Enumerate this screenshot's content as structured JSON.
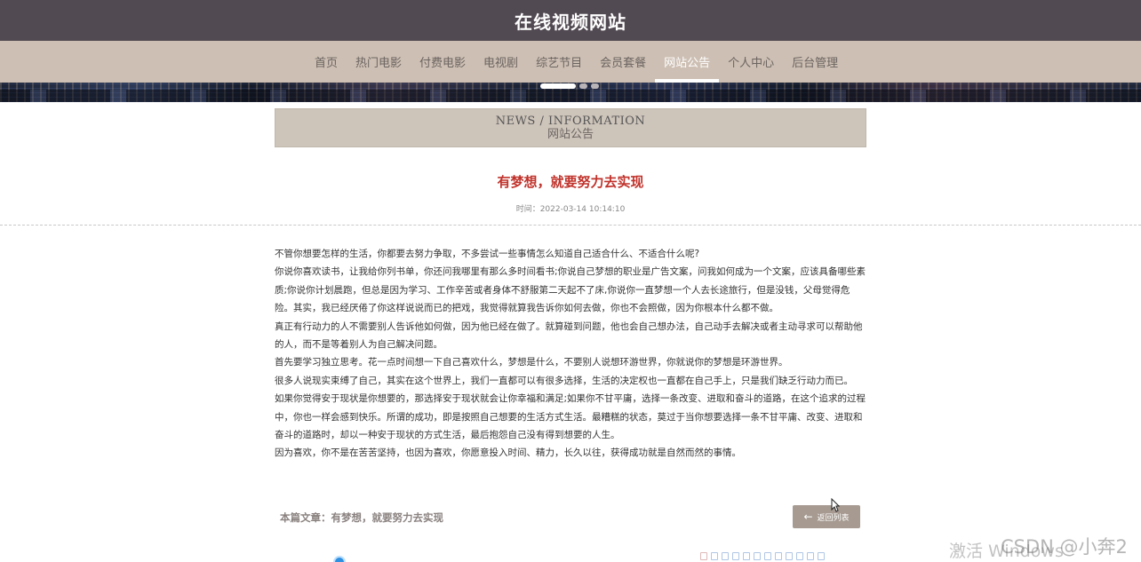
{
  "site": {
    "title": "在线视频网站"
  },
  "nav": {
    "items": [
      {
        "label": "首页",
        "active": false
      },
      {
        "label": "热门电影",
        "active": false
      },
      {
        "label": "付费电影",
        "active": false
      },
      {
        "label": "电视剧",
        "active": false
      },
      {
        "label": "综艺节目",
        "active": false
      },
      {
        "label": "会员套餐",
        "active": false
      },
      {
        "label": "网站公告",
        "active": true
      },
      {
        "label": "个人中心",
        "active": false
      },
      {
        "label": "后台管理",
        "active": false
      }
    ]
  },
  "banner": {
    "slide_count": 3,
    "active_slide": 1
  },
  "section": {
    "title_en": "NEWS / INFORMATION",
    "title_cn": "网站公告"
  },
  "article": {
    "title": "有梦想，就要努力去实现",
    "time": "时间：2022-03-14 10:14:10",
    "paragraphs": [
      "不管你想要怎样的生活，你都要去努力争取，不多尝试一些事情怎么知道自己适合什么、不适合什么呢?",
      "你说你喜欢读书，让我给你列书单，你还问我哪里有那么多时间看书;你说自己梦想的职业是广告文案，问我如何成为一个文案，应该具备哪些素质;你说你计划晨跑，但总是因为学习、工作辛苦或者身体不舒服第二天起不了床,你说你一直梦想一个人去长途旅行，但是没钱，父母觉得危险。其实，我已经厌倦了你这样说说而已的把戏，我觉得就算我告诉你如何去做，你也不会照做，因为你根本什么都不做。",
      "真正有行动力的人不需要别人告诉他如何做，因为他已经在做了。就算碰到问题，他也会自己想办法，自己动手去解决或者主动寻求可以帮助他的人，而不是等着别人为自己解决问题。",
      "首先要学习独立思考。花一点时间想一下自己喜欢什么，梦想是什么，不要别人说想环游世界，你就说你的梦想是环游世界。",
      "很多人说现实束缚了自己，其实在这个世界上，我们一直都可以有很多选择，生活的决定权也一直都在自己手上，只是我们缺乏行动力而已。",
      "如果你觉得安于现状是你想要的，那选择安于现状就会让你幸福和满足;如果你不甘平庸，选择一条改变、进取和奋斗的道路，在这个追求的过程中，你也一样会感到快乐。所谓的成功，即是按照自己想要的生活方式生活。最糟糕的状态，莫过于当你想要选择一条不甘平庸、改变、进取和奋斗的道路时，却以一种安于现状的方式生活，最后抱怨自己没有得到想要的人生。",
      "因为喜欢，你不是在苦苦坚持，也因为喜欢，你愿意投入时间、精力，长久以往，获得成功就是自然而然的事情。"
    ]
  },
  "footer": {
    "current_label": "本篇文章：有梦想，就要努力去实现",
    "back_label": "返回列表",
    "back_icon": "arrow-left-icon"
  },
  "overlay": {
    "watermark_activate": "激活 Windows",
    "watermark_csdn": "CSDN @小奔2"
  },
  "colors": {
    "header_bg": "#524a52",
    "nav_bg": "#cdbfb3",
    "nav_active_text": "#ffffff",
    "title_red": "#c0322b",
    "button_bg": "#a69a91"
  }
}
